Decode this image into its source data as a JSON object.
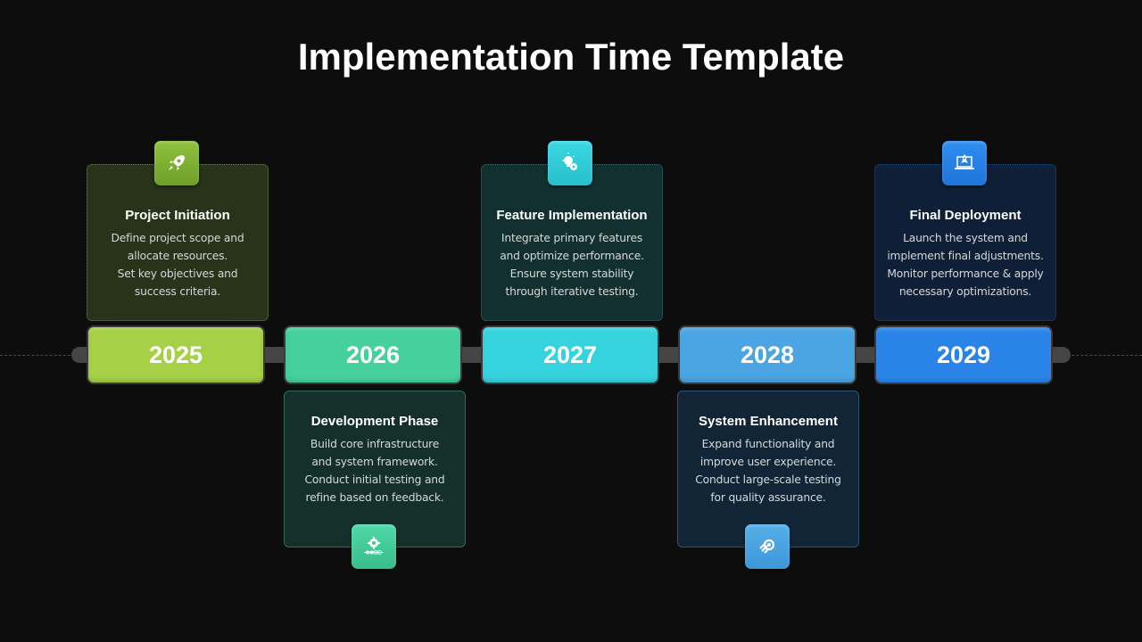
{
  "title": "Implementation Time Template",
  "milestones": [
    {
      "year": "2025",
      "heading": "Project Initiation",
      "lines": [
        "Define project scope and",
        "allocate resources.",
        "Set key objectives and",
        "success criteria."
      ],
      "icon": "rocket-icon",
      "position": "top",
      "color": "#a6d046",
      "card_bg": "#28331a",
      "card_border": "#6b8a2c"
    },
    {
      "year": "2026",
      "heading": "Development Phase",
      "lines": [
        "Build core infrastructure",
        "and system framework.",
        "Conduct initial testing and",
        "refine based on feedback."
      ],
      "icon": "gear-progress-icon",
      "position": "bottom",
      "color": "#45d09e",
      "card_bg": "#15302a",
      "card_border": "#2c6a55"
    },
    {
      "year": "2027",
      "heading": "Feature Implementation",
      "lines": [
        "Integrate primary features",
        "and optimize performance.",
        "Ensure system stability",
        "through iterative testing."
      ],
      "icon": "lightbulb-gear-icon",
      "position": "top",
      "color": "#36d3df",
      "card_bg": "#12302f",
      "card_border": "#2a7075"
    },
    {
      "year": "2028",
      "heading": "System Enhancement",
      "lines": [
        "Expand functionality and",
        "improve user experience.",
        "Conduct large-scale testing",
        "for quality assurance."
      ],
      "icon": "gear-rocket-icon",
      "position": "bottom",
      "color": "#4aa5e2",
      "card_bg": "#112536",
      "card_border": "#2a5678"
    },
    {
      "year": "2029",
      "heading": "Final Deployment",
      "lines": [
        "Launch the system and",
        "implement final adjustments.",
        "Monitor performance & apply",
        "necessary optimizations."
      ],
      "icon": "laptop-rocket-icon",
      "position": "top",
      "color": "#2a84e8",
      "card_bg": "#0f1f38",
      "card_border": "#244c80"
    }
  ]
}
